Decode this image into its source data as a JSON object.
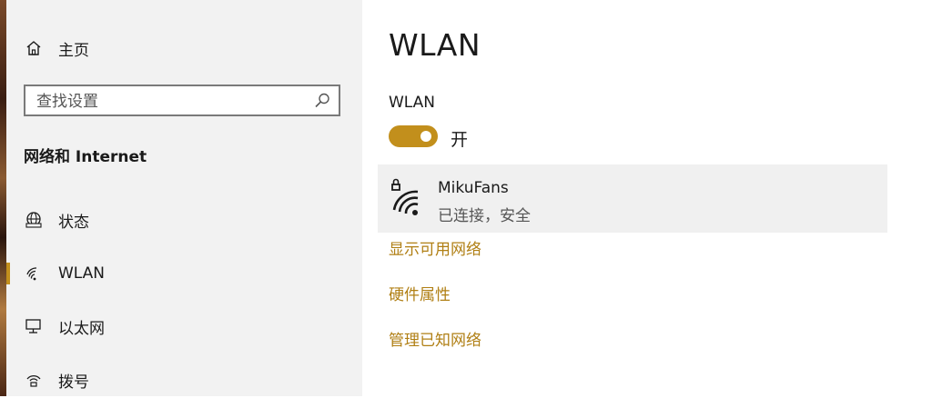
{
  "sidebar": {
    "home_label": "主页",
    "search_placeholder": "查找设置",
    "section_title": "网络和 Internet",
    "items": [
      {
        "label": "状态",
        "icon": "globe-status-icon"
      },
      {
        "label": "WLAN",
        "icon": "wifi-icon",
        "selected": true
      },
      {
        "label": "以太网",
        "icon": "ethernet-icon"
      },
      {
        "label": "拨号",
        "icon": "dialup-icon"
      }
    ]
  },
  "main": {
    "title": "WLAN",
    "toggle": {
      "caption": "WLAN",
      "state_label": "开",
      "on": true
    },
    "network": {
      "name": "MikuFans",
      "status": "已连接，安全",
      "icon": "wifi-secured-icon"
    },
    "links": [
      "显示可用网络",
      "硬件属性",
      "管理已知网络"
    ]
  },
  "colors": {
    "accent": "#c28f1c",
    "link": "#b07f14",
    "sidebar_bg": "#f2f2f2"
  }
}
